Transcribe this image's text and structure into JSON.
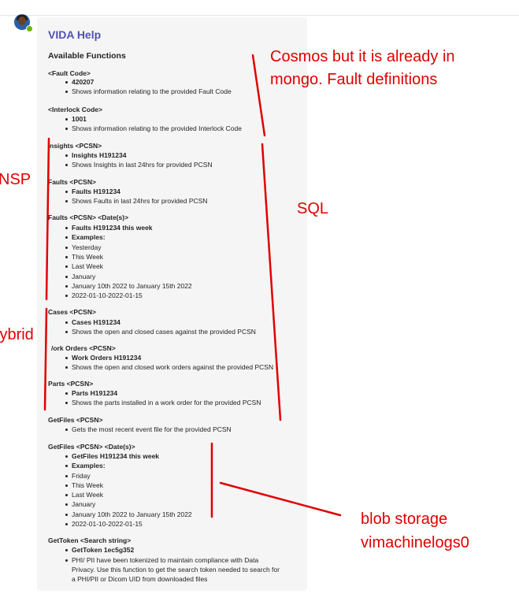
{
  "card": {
    "title": "VIDA Help",
    "subtitle": "Available Functions",
    "fault_header": "<Fault Code>",
    "fault_example": "420207",
    "fault_desc": "Shows information relating to the provided Fault Code",
    "interlock_header": "<Interlock Code>",
    "interlock_example": "1001",
    "interlock_desc": "Shows information relating to the provided Interlock Code",
    "insights_header": "nsights <PCSN>",
    "insights_example": "Insights H191234",
    "insights_desc": "Shows Insights in last 24hrs for provided PCSN",
    "faults_header": "Faults <PCSN>",
    "faults_example": "Faults H191234",
    "faults_desc": "Shows Faults in last 24hrs for provided PCSN",
    "faults_date_header": "Faults <PCSN> <Date(s)>",
    "faults_date_example": "Faults H191234 this week",
    "examples_label": "Examples:",
    "faults_date_items": [
      "Yesterday",
      "This Week",
      "Last Week",
      "January",
      "January 10th 2022 to January 15th 2022",
      "2022-01-10-2022-01-15"
    ],
    "cases_header": "Cases <PCSN>",
    "cases_example": "Cases H191234",
    "cases_desc": "Shows the open and closed cases against the provided PCSN",
    "workorders_header": "/ork Orders <PCSN>",
    "workorders_example": "Work Orders H191234",
    "workorders_desc": "Shows the open and closed work orders against the provided PCSN",
    "parts_header": "Parts <PCSN>",
    "parts_example": "Parts H191234",
    "parts_desc": "Shows the parts installed in a work order for the provided PCSN",
    "getfiles_header": "GetFiles <PCSN>",
    "getfiles_desc": "Gets the most recent event file for the provided PCSN",
    "getfiles_date_header": "GetFiles <PCSN> <Date(s)>",
    "getfiles_date_example": "GetFiles H191234 this week",
    "getfiles_date_items": [
      "Friday",
      "This Week",
      "Last Week",
      "January",
      "January 10th 2022 to January 15th 2022",
      "2022-01-10-2022-01-15"
    ],
    "gettoken_header": "GetToken <Search string>",
    "gettoken_example": "GetToken 1ec5g352",
    "gettoken_desc_1": "PHI/ PII have been tokenized to maintain compliance with Data",
    "gettoken_desc_2": "Privacy. Use this function to get the search token needed to search for",
    "gettoken_desc_3": "a PHI/PII or Dicom UID from downloaded files"
  },
  "annotations": {
    "cosmos_1": "Cosmos but it is already in",
    "cosmos_2": "mongo. Fault definitions",
    "nsp": "NSP",
    "sql": "SQL",
    "hybrid": "Hybrid",
    "blob_1": "blob storage",
    "blob_2": "vimachinelogs0"
  },
  "colors": {
    "annotation": "#e00000",
    "title": "#4f52b2",
    "card_bg": "#f5f5f5"
  }
}
